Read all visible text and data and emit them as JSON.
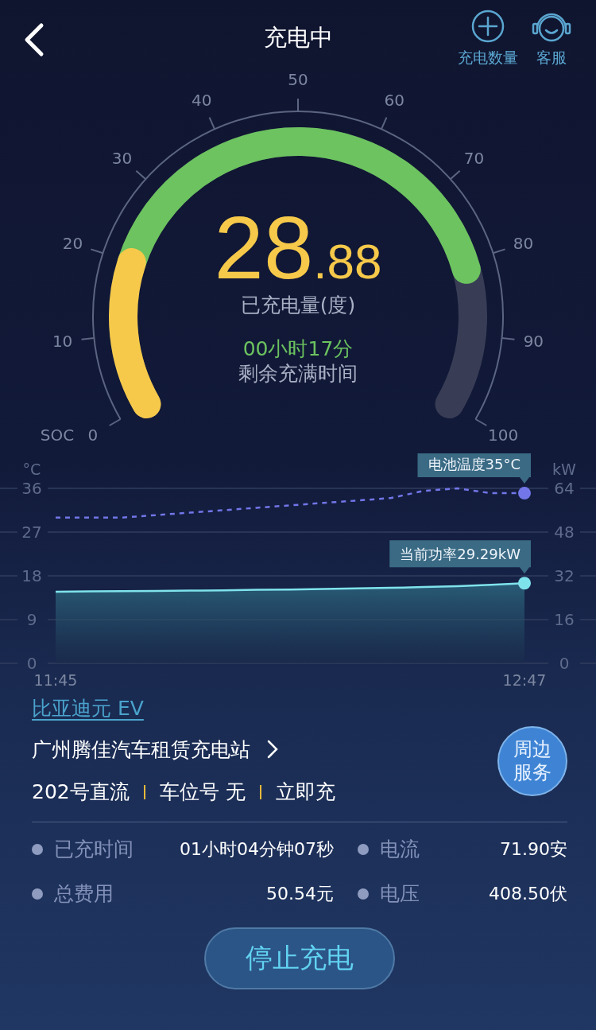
{
  "header": {
    "title": "充电中",
    "actions": [
      {
        "kind": "add",
        "label": "充电数量"
      },
      {
        "kind": "service",
        "label": "客服"
      }
    ]
  },
  "gauge": {
    "scale_label": "SOC",
    "scale": [
      "0",
      "10",
      "20",
      "30",
      "40",
      "50",
      "60",
      "70",
      "80",
      "90",
      "100"
    ],
    "energy_integer": "28",
    "energy_decimal": ".88",
    "energy_label": "已充电量(度)",
    "remaining_time": "00小时17分",
    "remaining_label": "剩余充满时间"
  },
  "chart": {
    "chart_data": {
      "type": "line",
      "ylabel": "°C",
      "y2label": "kW",
      "categories": [
        "11:45",
        null,
        null,
        null,
        null,
        null,
        null,
        null,
        null,
        null,
        null,
        null,
        null,
        null,
        "12:47"
      ],
      "grid": true,
      "ylim": [
        0,
        36
      ],
      "yticks": [
        0,
        9,
        18,
        27,
        36
      ],
      "y2lim": [
        0,
        64
      ],
      "y2ticks": [
        0,
        16,
        32,
        48,
        64
      ],
      "series": [
        {
          "color": "#7276e8",
          "line_style": "dashed",
          "values": [
            30,
            30,
            30,
            30.5,
            31,
            31.5,
            32,
            32.5,
            33,
            33.5,
            34,
            35.5,
            36,
            35,
            35
          ]
        },
        {
          "color": "#7fe3ec",
          "axis": "y2",
          "values": [
            26.2,
            26.3,
            26.4,
            26.5,
            26.6,
            26.7,
            26.9,
            27,
            27.2,
            27.4,
            27.6,
            27.9,
            28.2,
            28.7,
            29.3
          ]
        }
      ],
      "annotations": [
        "电池温度35°C",
        "当前功率29.29kW"
      ]
    }
  },
  "vehicle": {
    "name": "比亚迪元 EV"
  },
  "station": {
    "name": "广州腾佳汽车租赁充电站",
    "tags": [
      "202号直流",
      "车位号 无",
      "立即充"
    ],
    "nearby_button": "周边服务"
  },
  "stats": [
    {
      "label": "已充时间",
      "value": "01小时04分钟07秒"
    },
    {
      "label": "电流",
      "value": "71.90安"
    },
    {
      "label": "总费用",
      "value": "50.54元"
    },
    {
      "label": "电压",
      "value": "408.50伏"
    }
  ],
  "stop_button": "停止充电"
}
